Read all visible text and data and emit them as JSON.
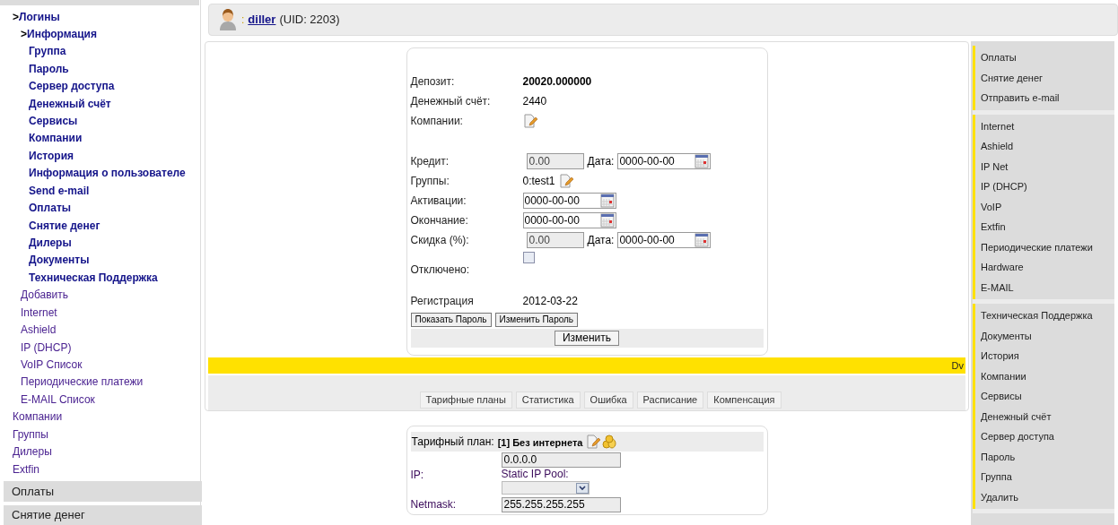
{
  "sidebar": {
    "tree": [
      {
        "label": "Логины",
        "prefix": ">",
        "bold": true,
        "children": [
          {
            "label": "Информация",
            "prefix": ">",
            "bold": true,
            "children": [
              {
                "label": "Группа",
                "bold": true
              },
              {
                "label": "Пароль",
                "bold": true
              },
              {
                "label": "Сервер доступа",
                "bold": true
              },
              {
                "label": "Денежный счёт",
                "bold": true
              },
              {
                "label": "Сервисы",
                "bold": true
              },
              {
                "label": "Компании",
                "bold": true
              },
              {
                "label": "История",
                "bold": true
              },
              {
                "label": "Информация о пользователе",
                "bold": true
              },
              {
                "label": "Send e-mail",
                "bold": true
              },
              {
                "label": "Оплаты",
                "bold": true
              },
              {
                "label": "Снятие денег",
                "bold": true
              },
              {
                "label": "Дилеры",
                "bold": true
              },
              {
                "label": "Документы",
                "bold": true
              },
              {
                "label": "Техническая Поддержка",
                "bold": true
              }
            ]
          },
          {
            "label": "Добавить",
            "bold": false
          },
          {
            "label": "Internet",
            "bold": false
          },
          {
            "label": "Ashield",
            "bold": false
          },
          {
            "label": "IP (DHCP)",
            "bold": false
          },
          {
            "label": "VoIP Список",
            "bold": false
          },
          {
            "label": "Периодические платежи",
            "bold": false
          },
          {
            "label": "E-MAIL Список",
            "bold": false
          }
        ]
      },
      {
        "label": "Компании",
        "bold": false
      },
      {
        "label": "Группы",
        "bold": false
      },
      {
        "label": "Дилеры",
        "bold": false
      },
      {
        "label": "Extfin",
        "bold": false
      }
    ],
    "sections": [
      "Оплаты",
      "Снятие денег"
    ]
  },
  "user": {
    "separator": ":",
    "name": "diller",
    "uid": "(UID: 2203)"
  },
  "account_form": {
    "rows": [
      {
        "kind": "text",
        "label": "Депозит:",
        "value": "20020.000000",
        "bold": true
      },
      {
        "kind": "text",
        "label": "Денежный счёт:",
        "value": "2440",
        "bold": false
      },
      {
        "kind": "edit",
        "label": "Компании:"
      },
      {
        "kind": "amount_date",
        "label": "Кредит:",
        "value": "0.00",
        "disabled": true,
        "date_label": "Дата:",
        "date": "0000-00-00"
      },
      {
        "kind": "group",
        "label": "Группы:",
        "value": "0:test1"
      },
      {
        "kind": "date",
        "label": "Активации:",
        "date": "0000-00-00"
      },
      {
        "kind": "date",
        "label": "Окончание:",
        "date": "0000-00-00"
      },
      {
        "kind": "amount_date",
        "label": "Скидка (%):",
        "value": "0.00",
        "disabled": true,
        "date_label": "Дата:",
        "date": "0000-00-00"
      },
      {
        "kind": "checkbox",
        "label": "Отключено:",
        "checked": false
      },
      {
        "kind": "text",
        "label": "Регистрация",
        "value": "2012-03-22",
        "bold": false
      }
    ],
    "buttons": [
      "Показать Пароль",
      "Изменить Пароль"
    ],
    "submit": "Изменить"
  },
  "banner": {
    "text": "Dv"
  },
  "tabs": [
    "Тарифные планы",
    "Статистика",
    "Ошибка",
    "Расписание",
    "Компенсация"
  ],
  "tariff_form": {
    "plan_label": "Тарифный план:",
    "plan": "[1] Без интернета",
    "ip_label": "IP:",
    "ip": "0.0.0.0",
    "pool_label": "Static IP Pool:",
    "netmask_label": "Netmask:",
    "netmask": "255.255.255.255"
  },
  "right_menu": {
    "groups": [
      [
        "Оплаты",
        "Снятие денег",
        "Отправить e-mail"
      ],
      [
        "Internet",
        "Ashield",
        "IP Net",
        "IP (DHCP)",
        "VoIP",
        "Extfin",
        "Периодические платежи",
        "Hardware",
        "E-MAIL"
      ],
      [
        "Техническая Поддержка",
        "Документы",
        "История",
        "Компании",
        "Сервисы",
        "Денежный счёт",
        "Сервер доступа",
        "Пароль",
        "Группа",
        "Удалить"
      ]
    ]
  }
}
